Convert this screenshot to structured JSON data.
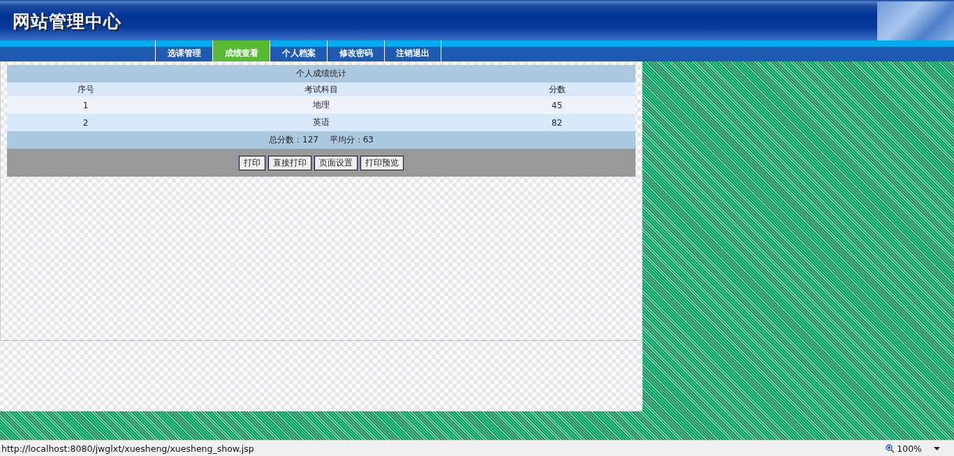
{
  "header": {
    "title": "网站管理中心"
  },
  "menu": [
    {
      "label": "选课管理",
      "selected": false
    },
    {
      "label": "成绩查看",
      "selected": true
    },
    {
      "label": "个人档案",
      "selected": false
    },
    {
      "label": "修改密码",
      "selected": false
    },
    {
      "label": "注销退出",
      "selected": false
    }
  ],
  "report": {
    "title": "个人成绩统计",
    "columns": [
      "序号",
      "考试科目",
      "分数"
    ],
    "rows": [
      [
        "1",
        "地理",
        "45"
      ],
      [
        "2",
        "英语",
        "82"
      ]
    ],
    "summary": "总分数：127　 平均分：63",
    "buttons": [
      "打印",
      "直接打印",
      "页面设置",
      "打印预览"
    ]
  },
  "status_bar": {
    "url": "http://localhost:8080/jwglxt/xuesheng/xuesheng_show.jsp",
    "zoom": "100%"
  }
}
